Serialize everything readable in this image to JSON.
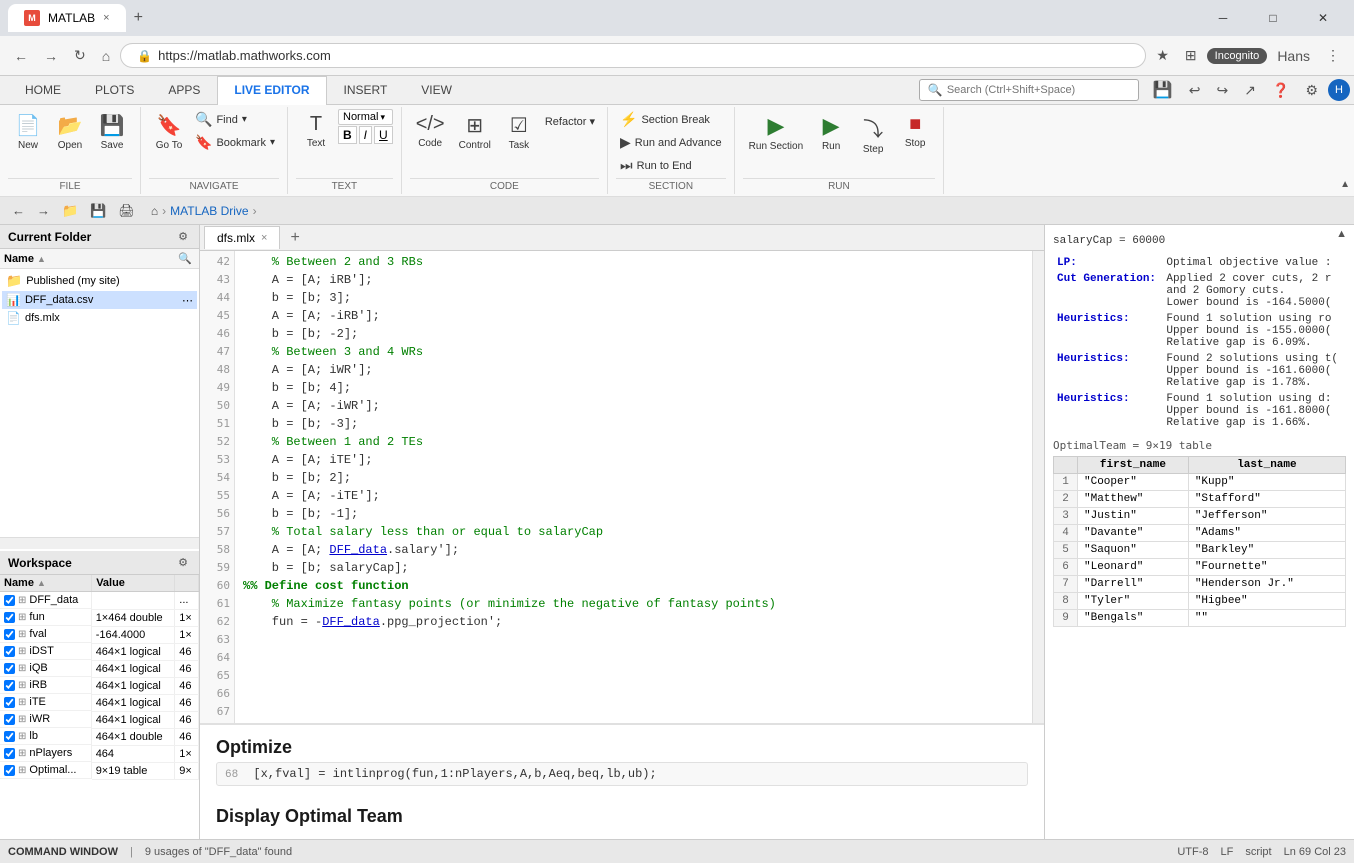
{
  "browser": {
    "tab_title": "MATLAB",
    "tab_close": "×",
    "new_tab": "+",
    "address": "https://matlab.mathworks.com",
    "lock_icon": "🔒",
    "back": "←",
    "forward": "→",
    "refresh": "↻",
    "home": "⌂",
    "star": "★",
    "extensions": "⊞",
    "menu": "⋮",
    "incognito": "Incognito",
    "win_min": "─",
    "win_max": "□",
    "win_close": "✕",
    "user": "Hans",
    "profile_icon": "👤"
  },
  "ribbon": {
    "tabs": [
      "HOME",
      "PLOTS",
      "APPS",
      "LIVE EDITOR",
      "INSERT",
      "VIEW"
    ],
    "active_tab": "LIVE EDITOR",
    "search_placeholder": "Search (Ctrl+Shift+Space)",
    "groups": {
      "file": {
        "label": "FILE",
        "new_label": "New",
        "open_label": "Open",
        "save_label": "Save"
      },
      "navigate": {
        "label": "NAVIGATE",
        "go_to_label": "Go To",
        "find_label": "Find",
        "bookmark_label": "Bookmark"
      },
      "text": {
        "label": "TEXT",
        "text_label": "Text",
        "style": "Normal",
        "bold": "B",
        "italic": "I",
        "underline": "U"
      },
      "code": {
        "label": "CODE",
        "code_label": "Code",
        "control_label": "Control",
        "task_label": "Task",
        "refactor_label": "Refactor ▾"
      },
      "section": {
        "label": "SECTION",
        "section_break": "Section Break",
        "run_and_advance": "Run and Advance",
        "run_to_end": "Run to End"
      },
      "run": {
        "label": "RUN",
        "run_section_label": "Run Section",
        "run_label": "Run",
        "step_label": "Step",
        "stop_label": "Stop"
      }
    }
  },
  "toolbar": {
    "back": "←",
    "forward": "→",
    "breadcrumb": [
      "",
      ">",
      "MATLAB Drive",
      ">"
    ]
  },
  "current_folder": {
    "title": "Current Folder",
    "name_col": "Name",
    "sort_icon": "▲",
    "items": [
      {
        "type": "folder",
        "name": "Published (my site)"
      },
      {
        "type": "file",
        "name": "DFF_data.csv",
        "selected": true
      },
      {
        "type": "file",
        "name": "dfs.mlx"
      }
    ]
  },
  "workspace": {
    "title": "Workspace",
    "cols": [
      "Name",
      "Value",
      ""
    ],
    "rows": [
      {
        "name": "DFF_data",
        "value": "",
        "size": "..."
      },
      {
        "name": "fun",
        "value": "1×464 double",
        "size": "1×"
      },
      {
        "name": "fval",
        "value": "-164.4000",
        "size": "1×"
      },
      {
        "name": "iDST",
        "value": "464×1 logical",
        "size": "46"
      },
      {
        "name": "iQB",
        "value": "464×1 logical",
        "size": "46"
      },
      {
        "name": "iRB",
        "value": "464×1 logical",
        "size": "46"
      },
      {
        "name": "iTE",
        "value": "464×1 logical",
        "size": "46"
      },
      {
        "name": "iWR",
        "value": "464×1 logical",
        "size": "46"
      },
      {
        "name": "lb",
        "value": "464×1 double",
        "size": "46"
      },
      {
        "name": "nPlayers",
        "value": "464",
        "size": "1×"
      },
      {
        "name": "Optimal...",
        "value": "9×19 table",
        "size": "9×"
      }
    ]
  },
  "editor": {
    "tab_name": "dfs.mlx",
    "new_tab_icon": "+",
    "lines": [
      {
        "num": 42,
        "text": "    % Between 2 and 3 RBs",
        "type": "comment"
      },
      {
        "num": 43,
        "text": "    A = [A; iRB'];",
        "type": "code"
      },
      {
        "num": 44,
        "text": "    b = [b; 3];",
        "type": "code"
      },
      {
        "num": 45,
        "text": "    A = [A; -iRB'];",
        "type": "code"
      },
      {
        "num": 46,
        "text": "    b = [b; -2];",
        "type": "code"
      },
      {
        "num": 47,
        "text": "",
        "type": "code"
      },
      {
        "num": 48,
        "text": "    % Between 3 and 4 WRs",
        "type": "comment"
      },
      {
        "num": 49,
        "text": "    A = [A; iWR'];",
        "type": "code"
      },
      {
        "num": 50,
        "text": "    b = [b; 4];",
        "type": "code"
      },
      {
        "num": 51,
        "text": "    A = [A; -iWR'];",
        "type": "code"
      },
      {
        "num": 52,
        "text": "    b = [b; -3];",
        "type": "code"
      },
      {
        "num": 53,
        "text": "",
        "type": "code"
      },
      {
        "num": 54,
        "text": "    % Between 1 and 2 TEs",
        "type": "comment"
      },
      {
        "num": 55,
        "text": "    A = [A; iTE'];",
        "type": "code"
      },
      {
        "num": 56,
        "text": "    b = [b; 2];",
        "type": "code"
      },
      {
        "num": 57,
        "text": "    A = [A; -iTE'];",
        "type": "code"
      },
      {
        "num": 58,
        "text": "    b = [b; -1];",
        "type": "code"
      },
      {
        "num": 59,
        "text": "",
        "type": "code"
      },
      {
        "num": 60,
        "text": "    % Total salary less than or equal to salaryCap",
        "type": "comment"
      },
      {
        "num": 61,
        "text": "    A = [A; DFF_data.salary'];",
        "type": "code"
      },
      {
        "num": 62,
        "text": "    b = [b; salaryCap];",
        "type": "code"
      },
      {
        "num": 63,
        "text": "",
        "type": "code"
      },
      {
        "num": 64,
        "text": "%% Define cost function",
        "type": "section_comment"
      },
      {
        "num": 65,
        "text": "",
        "type": "code"
      },
      {
        "num": 66,
        "text": "    % Maximize fantasy points (or minimize the negative of fantasy points)",
        "type": "comment"
      },
      {
        "num": 67,
        "text": "    fun = -DFF_data.ppg_projection';",
        "type": "code"
      },
      {
        "num": 68,
        "text": "",
        "type": "code"
      }
    ],
    "section_heading_optimize": "Optimize",
    "section_code_68": "[x,fval] = intlinprog(fun,1:nPlayers,A,b,Aeq,beq,lb,ub);",
    "section_heading_display": "Display Optimal Team"
  },
  "output_panel": {
    "salary_cap_line": "salaryCap = 60000",
    "lp_label": "LP:",
    "lp_value": "Optimal objective value :",
    "cut_label": "Cut Generation:",
    "cut_value": "Applied 2 cover cuts, 2 r\nand 2 Gomory cuts.\nLower bound is -164.5000(",
    "h1_label": "Heuristics:",
    "h1_value": "Found 1 solution using ro\nUpper bound is -155.0000(\nRelative gap is 6.09%.",
    "h2_label": "Heuristics:",
    "h2_value": "Found 2 solutions using t(\nUpper bound is -161.6000(\nRelative gap is 1.78%.",
    "h3_label": "Heuristics:",
    "h3_value": "Found 1 solution using d:\nUpper bound is -161.8000(\nRelative gap is 1.66%.",
    "table_title": "OptimalTeam = 9×19 table",
    "table_cols": [
      "first_name",
      "last_name"
    ],
    "table_rows": [
      {
        "num": 1,
        "first_name": "\"Cooper\"",
        "last_name": "\"Kupp\""
      },
      {
        "num": 2,
        "first_name": "\"Matthew\"",
        "last_name": "\"Stafford\""
      },
      {
        "num": 3,
        "first_name": "\"Justin\"",
        "last_name": "\"Jefferson\""
      },
      {
        "num": 4,
        "first_name": "\"Davante\"",
        "last_name": "\"Adams\""
      },
      {
        "num": 5,
        "first_name": "\"Saquon\"",
        "last_name": "\"Barkley\""
      },
      {
        "num": 6,
        "first_name": "\"Leonard\"",
        "last_name": "\"Fournette\""
      },
      {
        "num": 7,
        "first_name": "\"Darrell\"",
        "last_name": "\"Henderson Jr.\""
      },
      {
        "num": 8,
        "first_name": "\"Tyler\"",
        "last_name": "\"Higbee\""
      },
      {
        "num": 9,
        "first_name": "\"Bengals\"",
        "last_name": "\"\""
      }
    ]
  },
  "status_bar": {
    "command_window": "COMMAND WINDOW",
    "search_result": "9 usages of \"DFF_data\" found",
    "encoding": "UTF-8",
    "line_ending": "LF",
    "mode": "script",
    "position": "Ln 69  Col 23"
  }
}
